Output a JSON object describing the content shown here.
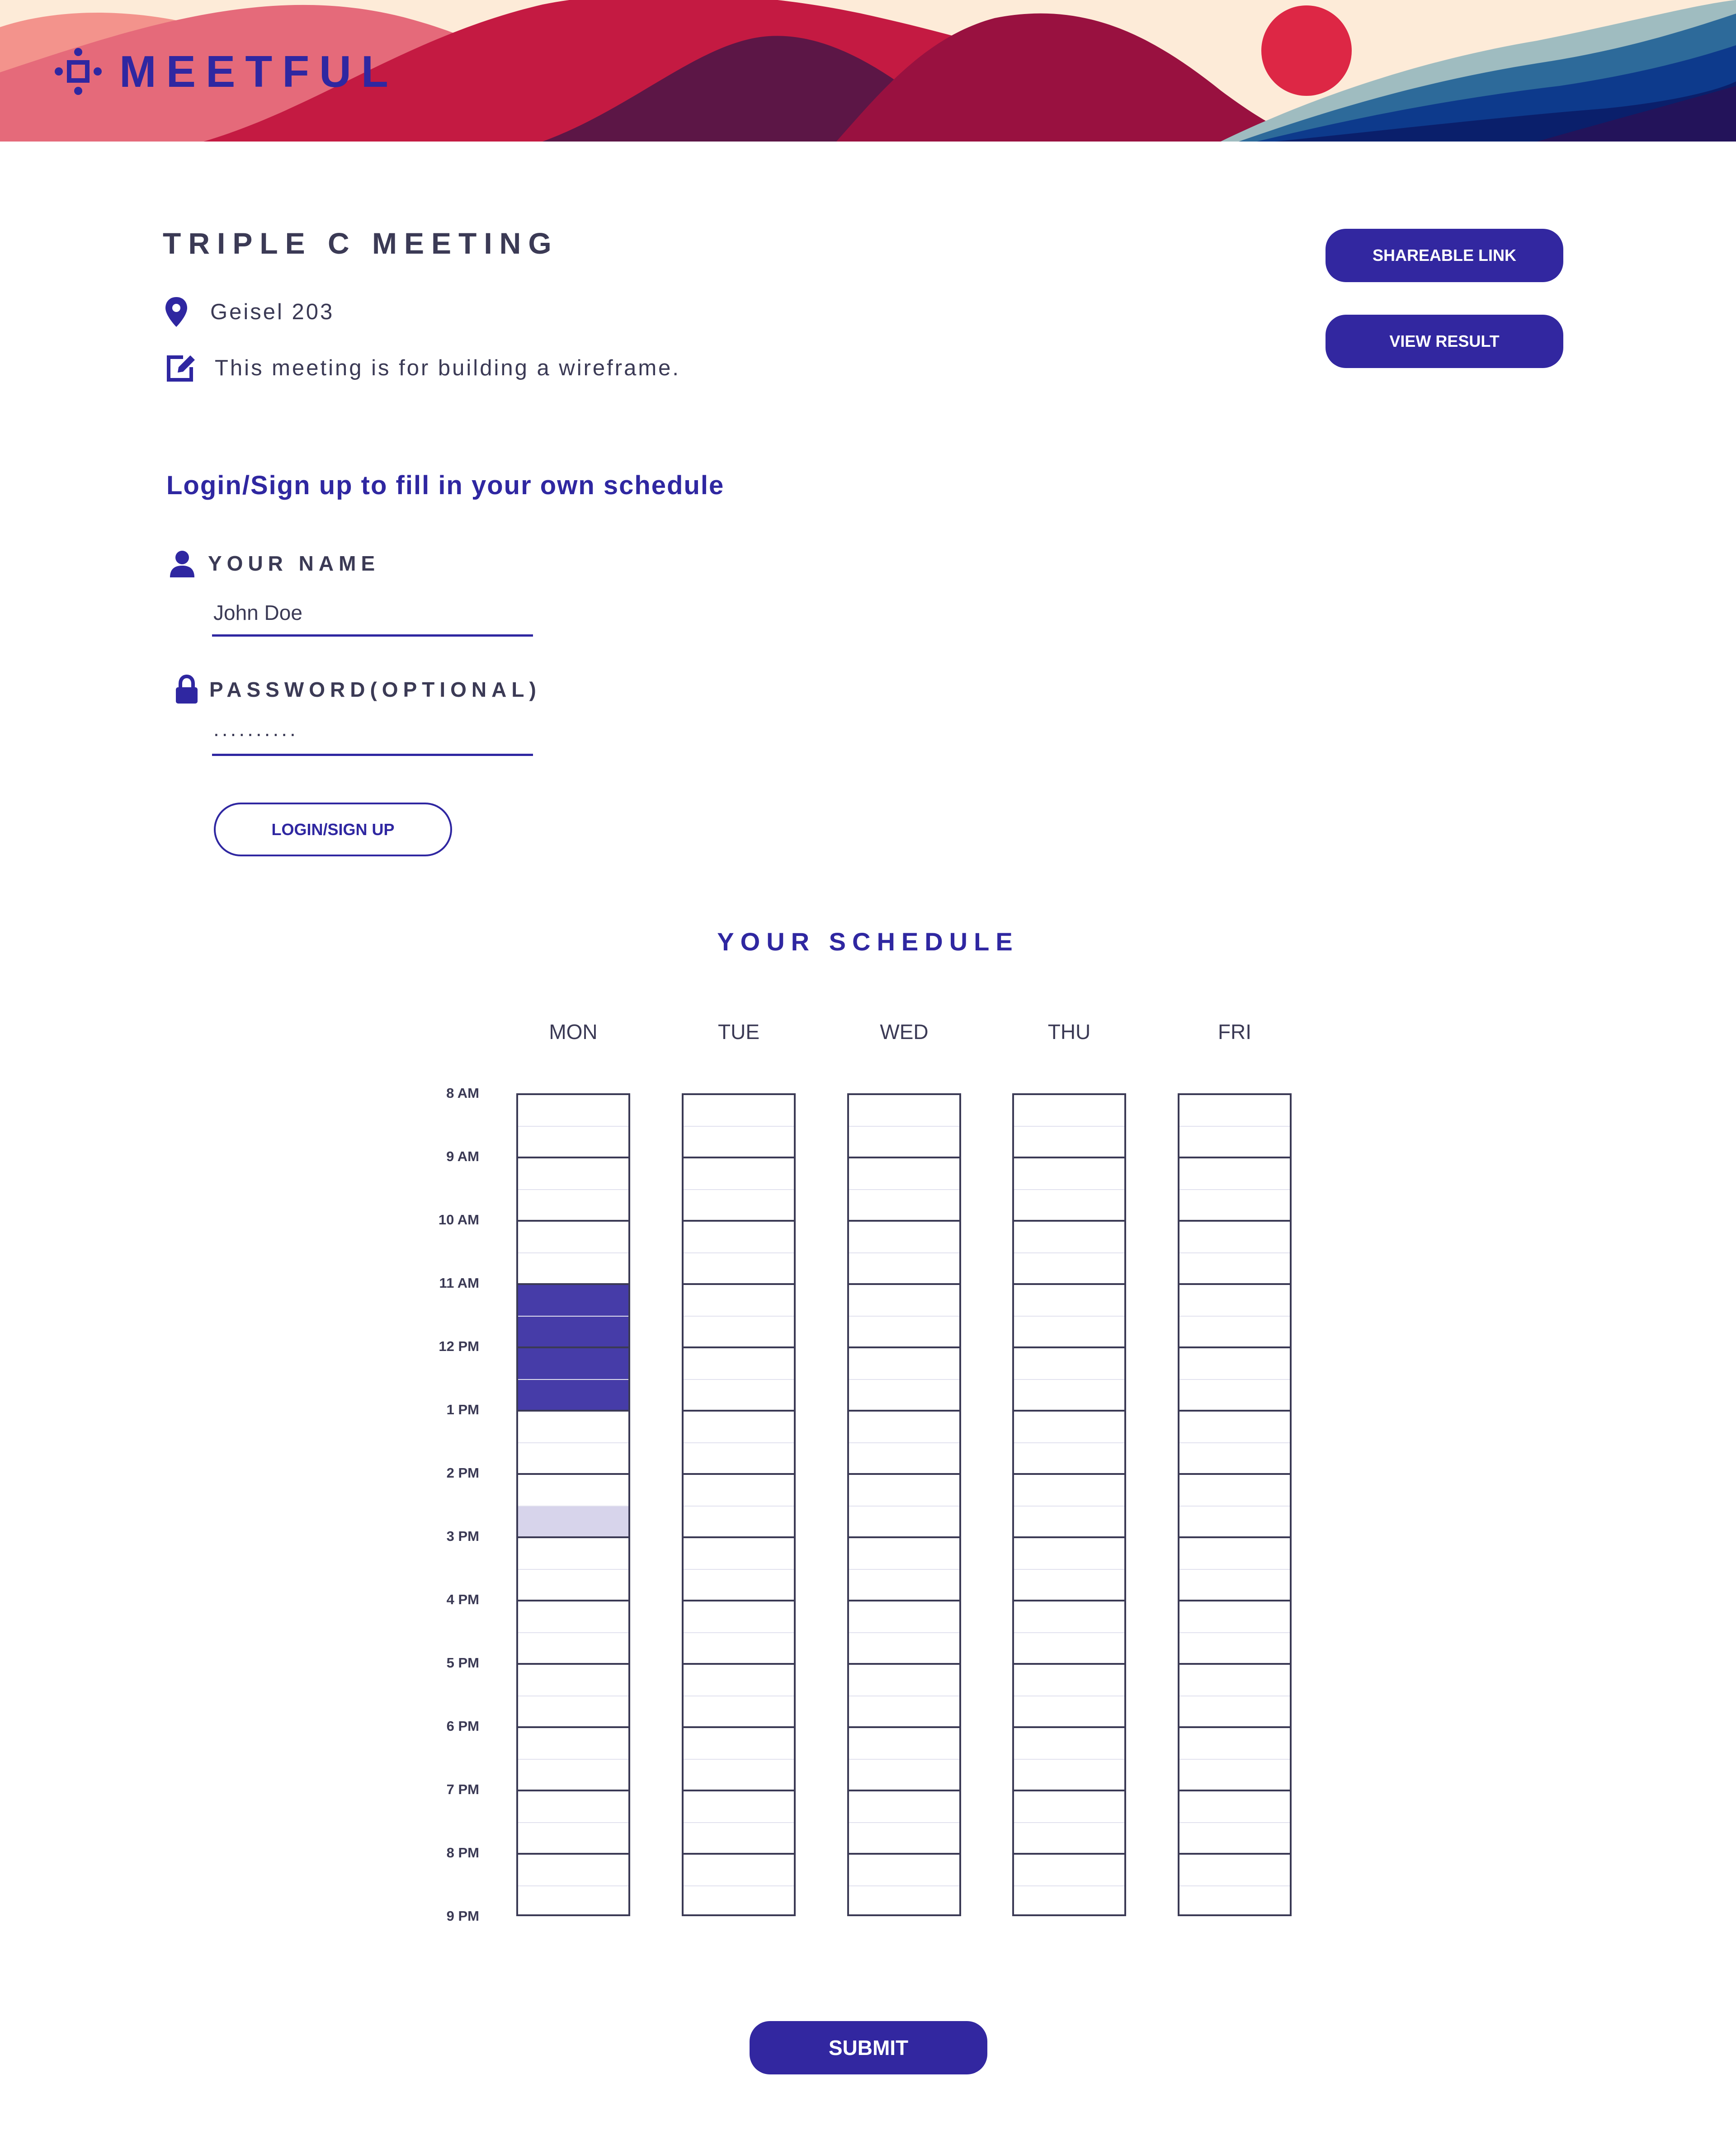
{
  "header": {
    "logo_text": "MEETFUL"
  },
  "meeting": {
    "title": "TRIPLE C MEETING",
    "location": "Geisel 203",
    "description": "This meeting is for building a wireframe."
  },
  "actions": {
    "shareable_link_label": "SHAREABLE LINK",
    "view_result_label": "VIEW RESULT"
  },
  "login": {
    "heading": "Login/Sign up to fill in your own schedule",
    "name_label": "YOUR NAME",
    "name_value": "John Doe",
    "password_label": "PASSWORD(OPTIONAL)",
    "password_value": "..........",
    "button_label": "LOGIN/SIGN UP"
  },
  "schedule": {
    "heading": "YOUR SCHEDULE",
    "days": [
      "MON",
      "TUE",
      "WED",
      "THU",
      "FRI"
    ],
    "times": [
      "8 AM",
      "9 AM",
      "10 AM",
      "11 AM",
      "12 PM",
      "1 PM",
      "2 PM",
      "3 PM",
      "4 PM",
      "5 PM",
      "6 PM",
      "7 PM",
      "8 PM",
      "9 PM"
    ],
    "selected_slots": {
      "MON": [
        "11:00",
        "11:30",
        "12:00",
        "12:30"
      ]
    },
    "tentative_slots": {
      "MON": [
        "14:30"
      ]
    },
    "colors": {
      "selected": "#463ca8",
      "tentative": "#d7d4eb",
      "accent": "#2f27a1"
    }
  },
  "footer": {
    "submit_label": "SUBMIT"
  }
}
